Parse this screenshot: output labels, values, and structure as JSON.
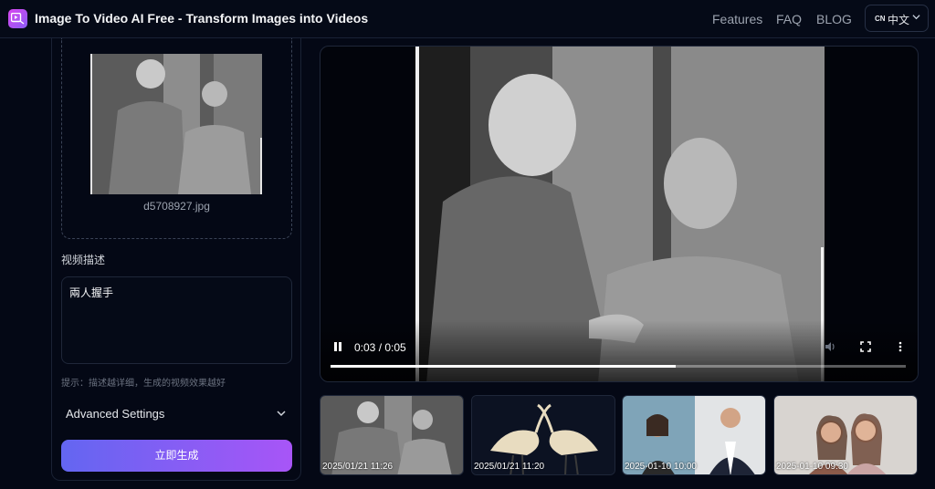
{
  "header": {
    "title": "Image To Video AI Free - Transform Images into Videos",
    "nav": [
      "Features",
      "FAQ",
      "BLOG"
    ],
    "lang_code": "CN",
    "lang_label": "中文"
  },
  "upload": {
    "file_name": "d5708927.jpg"
  },
  "form": {
    "desc_label": "视频描述",
    "desc_value": "兩人握手",
    "hint": "提示：描述越详细，生成的视频效果越好",
    "advanced_label": "Advanced Settings",
    "generate_label": "立即生成"
  },
  "player": {
    "time": "0:03 / 0:05",
    "progress": 0.6
  },
  "history": [
    {
      "timestamp": "2025/01/21 11:26",
      "theme": "two men grayscale photo"
    },
    {
      "timestamp": "2025/01/21 11:20",
      "theme": "two cranes"
    },
    {
      "timestamp": "2025-01-10 10:00",
      "theme": "woman and man portraits"
    },
    {
      "timestamp": "2025-01-10 09:30",
      "theme": "two women selfie"
    }
  ],
  "colors": {
    "accent_start": "#6366f1",
    "accent_end": "#a855f7",
    "background": "#040815"
  }
}
